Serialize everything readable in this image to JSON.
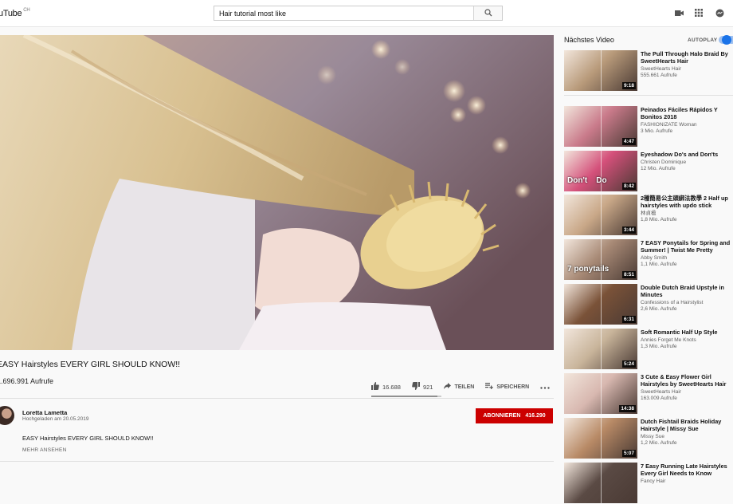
{
  "header": {
    "logo_text": "uTube",
    "country": "CH",
    "search_value": "Hair tutorial most like"
  },
  "video": {
    "title": "EASY Hairstyles EVERY GIRL SHOULD KNOW!!",
    "views": "1.696.991 Aufrufe",
    "likes": "16.688",
    "dislikes": "921",
    "like_ratio": 0.948,
    "share_label": "TEILEN",
    "save_label": "SPEICHERN",
    "channel": "Loretta Lametta",
    "upload_date": "Hochgeladen am 20.05.2019",
    "subscribe_label": "ABONNIEREN",
    "subscriber_count": "416.290",
    "description": "EASY Hairstyles EVERY GIRL SHOULD KNOW!!",
    "more_label": "MEHR ANSEHEN"
  },
  "sidebar": {
    "heading": "Nächstes Video",
    "autoplay_label": "AUTOPLAY",
    "autoplay_on": true,
    "items": [
      {
        "title": "The Pull Through Halo Braid By SweetHearts Hair",
        "channel": "SweetHearts Hair",
        "views": "555.661 Aufrufe",
        "duration": "9:18",
        "thumb_color": "#b89a7a"
      },
      {
        "title": "Peinados Fáciles Rápidos Y Bonitos 2018",
        "channel": "FASHIONIZATE Woman",
        "views": "3 Mio. Aufrufe",
        "duration": "4:47",
        "thumb_color": "#c97a8a"
      },
      {
        "title": "Eyeshadow Do's and Don'ts",
        "channel": "Christen Dominique",
        "views": "12 Mio. Aufrufe",
        "duration": "8:42",
        "thumb_color": "#d4507a",
        "thumb_text": "Don't    Do"
      },
      {
        "title": "2種簡易公主頭綁法教學 2 Half up hairstyles with updo stick",
        "channel": "林貞楹",
        "views": "1,8 Mio. Aufrufe",
        "duration": "3:44",
        "thumb_color": "#c9a888"
      },
      {
        "title": "7 EASY Ponytails for Spring and Summer! | Twist Me Pretty",
        "channel": "Abby Smith",
        "views": "1,1 Mio. Aufrufe",
        "duration": "8:51",
        "thumb_color": "#a88a76",
        "thumb_text": "7 ponytails"
      },
      {
        "title": "Double Dutch Braid Upstyle in Minutes",
        "channel": "Confessions of a Hairstylist",
        "views": "2,6 Mio. Aufrufe",
        "duration": "6:31",
        "thumb_color": "#7a5238"
      },
      {
        "title": "Soft Romantic Half Up Style",
        "channel": "Annies Forget Me Knots",
        "views": "1,3 Mio. Aufrufe",
        "duration": "5:24",
        "thumb_color": "#c8b49a"
      },
      {
        "title": "3 Cute & Easy Flower Girl Hairstyles by SweetHearts Hair",
        "channel": "SweetHearts Hair",
        "views": "163.009 Aufrufe",
        "duration": "14:38",
        "thumb_color": "#d8b8b0"
      },
      {
        "title": "Dutch Fishtail Braids Holiday Hairstyle | Missy Sue",
        "channel": "Missy Sue",
        "views": "1,2 Mio. Aufrufe",
        "duration": "5:07",
        "thumb_color": "#b88a66"
      },
      {
        "title": "7 Easy Running Late Hairstyles Every Girl Needs to Know",
        "channel": "Fancy Hair",
        "views": "",
        "duration": "",
        "thumb_color": "#5a4a44"
      }
    ]
  }
}
